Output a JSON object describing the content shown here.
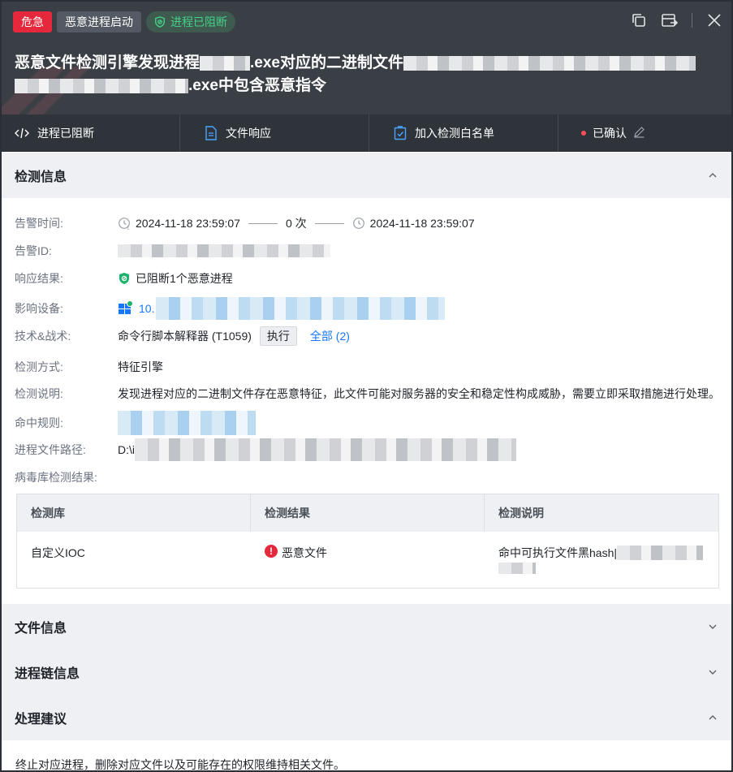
{
  "header": {
    "tags": {
      "severity": "危急",
      "type": "恶意进程启动",
      "status": "进程已阻断"
    },
    "title_part1": "恶意文件检测引擎发现进程",
    "title_part2": ".exe对应的二进制文件",
    "title_part3": ".exe中包含恶意指令",
    "controls": {
      "copy": "copy-icon",
      "export": "export-icon",
      "close": "close-icon"
    }
  },
  "actions": {
    "blocked": "进程已阻断",
    "file_response": "文件响应",
    "whitelist": "加入检测白名单",
    "confirmed": "已确认"
  },
  "sections": {
    "detection": "检测信息",
    "file_info": "文件信息",
    "process_chain": "进程链信息",
    "suggestion": "处理建议"
  },
  "detail": {
    "alert_time_label": "告警时间:",
    "alert_time_start": "2024-11-18 23:59:07",
    "alert_count": "0 次",
    "alert_time_end": "2024-11-18 23:59:07",
    "alert_id_label": "告警ID:",
    "response_label": "响应结果:",
    "response_value": "已阻断1个恶意进程",
    "device_label": "影响设备:",
    "device_value": "10.",
    "technique_label": "技术&战术:",
    "technique_value": "命令行脚本解释器 (T1059)",
    "technique_badge": "执行",
    "technique_all": "全部 (2)",
    "method_label": "检测方式:",
    "method_value": "特征引擎",
    "desc_label": "检测说明:",
    "desc_value": "发现进程对应的二进制文件存在恶意特征，此文件可能对服务器的安全和稳定性构成威胁，需要立即采取措施进行处理。",
    "rule_label": "命中规则:",
    "path_label": "进程文件路径:",
    "path_value": "D:\\i",
    "av_label": "病毒库检测结果:"
  },
  "table": {
    "headers": [
      "检测库",
      "检测结果",
      "检测说明"
    ],
    "rows": [
      {
        "lib": "自定义IOC",
        "result": "恶意文件",
        "desc": "命中可执行文件黑hash|"
      }
    ]
  },
  "suggestion_text": "终止对应进程，删除对应文件以及可能存在的权限维持相关文件。",
  "colors": {
    "danger": "#e5283c",
    "success": "#1bb36b",
    "link": "#1677ff",
    "header_bg": "#3a3f46"
  }
}
